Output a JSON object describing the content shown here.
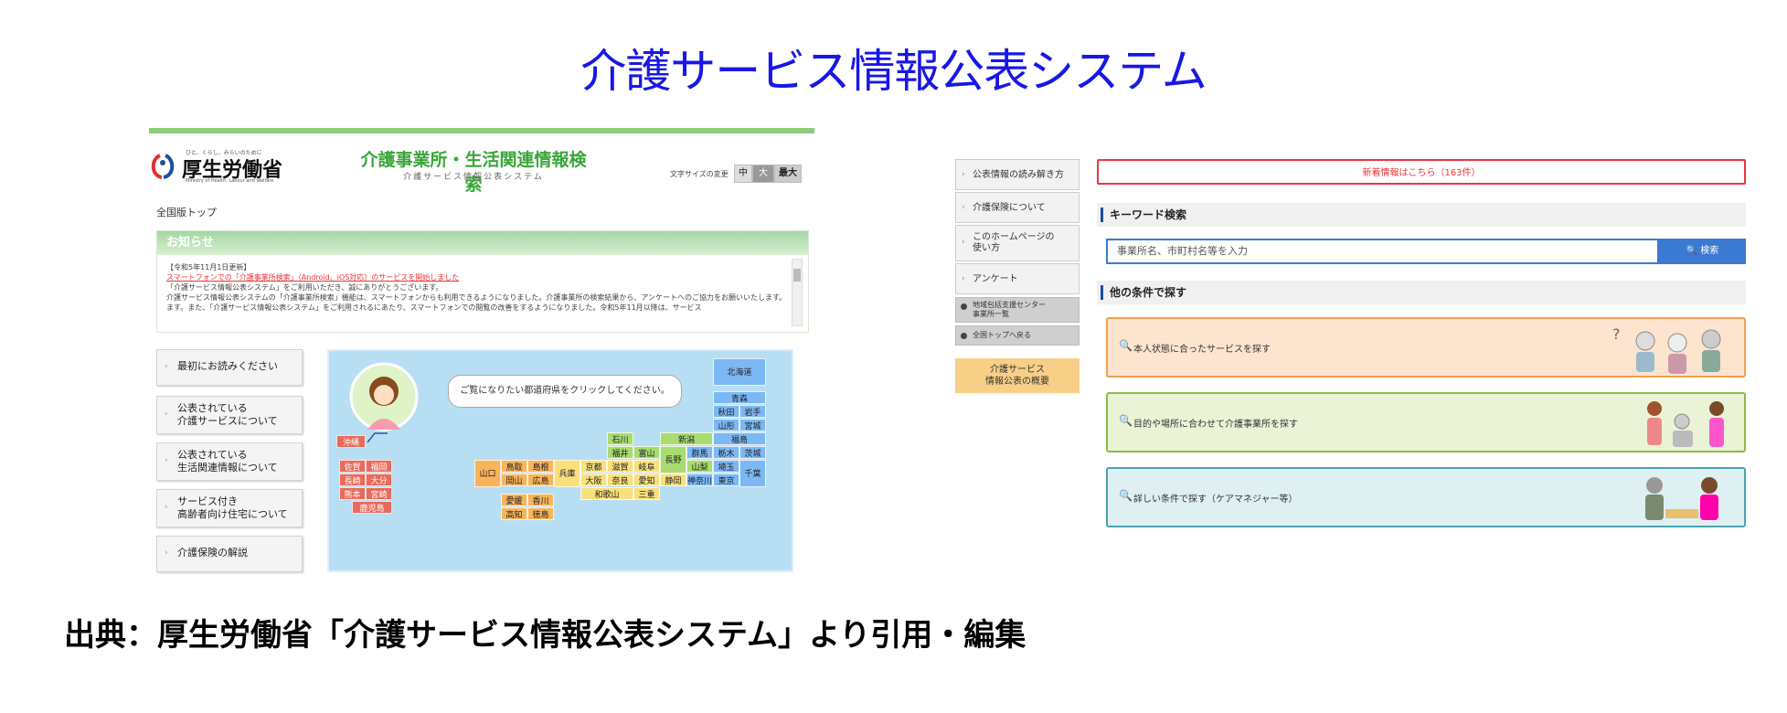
{
  "title": "介護サービス情報公表システム",
  "caption": "出典：厚生労働省「介護サービス情報公表システム」より引用・編集",
  "left": {
    "logo_tag": "ひと、くらし、みらいのために",
    "logo_name": "厚生労働省",
    "logo_en": "Ministry of Health, Labour and Welfare",
    "header_title": "介護事業所・生活関連情報検索",
    "header_sub": "介護サービス情報公表システム",
    "font_size_label": "文字サイズの変更",
    "font_sizes": [
      "中",
      "大",
      "最大"
    ],
    "breadcrumb": "全国版トップ",
    "news_title": "お知らせ",
    "news_lines": [
      "【令和5年11月1日更新】",
      "スマートフォンでの「介護事業所検索」（Android、iOS対応）のサービスを開始しました",
      "「介護サービス情報公表システム」をご利用いただき、誠にありがとうございます。",
      "介護サービス情報公表システムの「介護事業所検索」機能は、スマートフォンからも利用できるようになりました。介護事業所の検索結果から、アンケートへのご協力をお願いいたします。",
      "ます。また、「介護サービス情報公表システム」をご利用されるにあたり、スマートフォンでの閲覧の改善をするようになりました。令和5年11月以降は、サービス"
    ],
    "menu": [
      "最初にお読みください",
      "公表されている\n介護サービスについて",
      "公表されている\n生活関連情報について",
      "サービス付き\n高齢者向け住宅について",
      "介護保険の解説"
    ],
    "map_prompt": "ご覧になりたい都道府県をクリックしてください。",
    "prefectures": {
      "hokkaido": "北海道",
      "aomori": "青森",
      "akita": "秋田",
      "iwate": "岩手",
      "yamagata": "山形",
      "miyagi": "宮城",
      "fukushima": "福島",
      "niigata": "新潟",
      "gunma": "群馬",
      "tochigi": "栃木",
      "ibaraki": "茨城",
      "nagano": "長野",
      "yamanashi": "山梨",
      "saitama": "埼玉",
      "kanagawa": "神奈川",
      "tokyo": "東京",
      "chiba": "千葉",
      "ishikawa": "石川",
      "toyama": "富山",
      "fukui": "福井",
      "gifu": "岐阜",
      "shizuoka": "静岡",
      "aichi": "愛知",
      "kyoto": "京都",
      "shiga": "滋賀",
      "osaka": "大阪",
      "nara": "奈良",
      "mie": "三重",
      "wakayama": "和歌山",
      "hyogo": "兵庫",
      "tottori": "鳥取",
      "shimane": "島根",
      "okayama": "岡山",
      "hiroshima": "広島",
      "yamaguchi": "山口",
      "kagawa": "香川",
      "ehime": "愛媛",
      "tokushima": "徳島",
      "kochi": "高知",
      "fukuoka": "福岡",
      "saga": "佐賀",
      "nagasaki": "長崎",
      "oita": "大分",
      "kumamoto": "熊本",
      "miyazaki": "宮崎",
      "kagoshima": "鹿児島",
      "okinawa": "沖縄"
    }
  },
  "right": {
    "side_items": [
      "公表情報の読み解き方",
      "介護保険について",
      "このホームページの\n使い方",
      "アンケート"
    ],
    "side_gray": [
      "地域包括支援センター\n事業所一覧",
      "全国トップへ戻る"
    ],
    "side_orange": "介護サービス\n情報公表の概要",
    "notice": "新着情報はこちら（163件）",
    "keyword_title": "キーワード検索",
    "keyword_placeholder": "事業所名、市町村名等を入力",
    "search_button": "🔍 検索",
    "other_title": "他の条件で探す",
    "conditions": [
      "本人状態に合ったサービスを探す",
      "目的や場所に合わせて介護事業所を探す",
      "詳しい条件で探す（ケアマネジャー等）"
    ]
  },
  "colors": {
    "title": "#1717e6",
    "accent_green": "#3aa63a",
    "notice_red": "#e33",
    "button_blue": "#3b7ad2"
  }
}
